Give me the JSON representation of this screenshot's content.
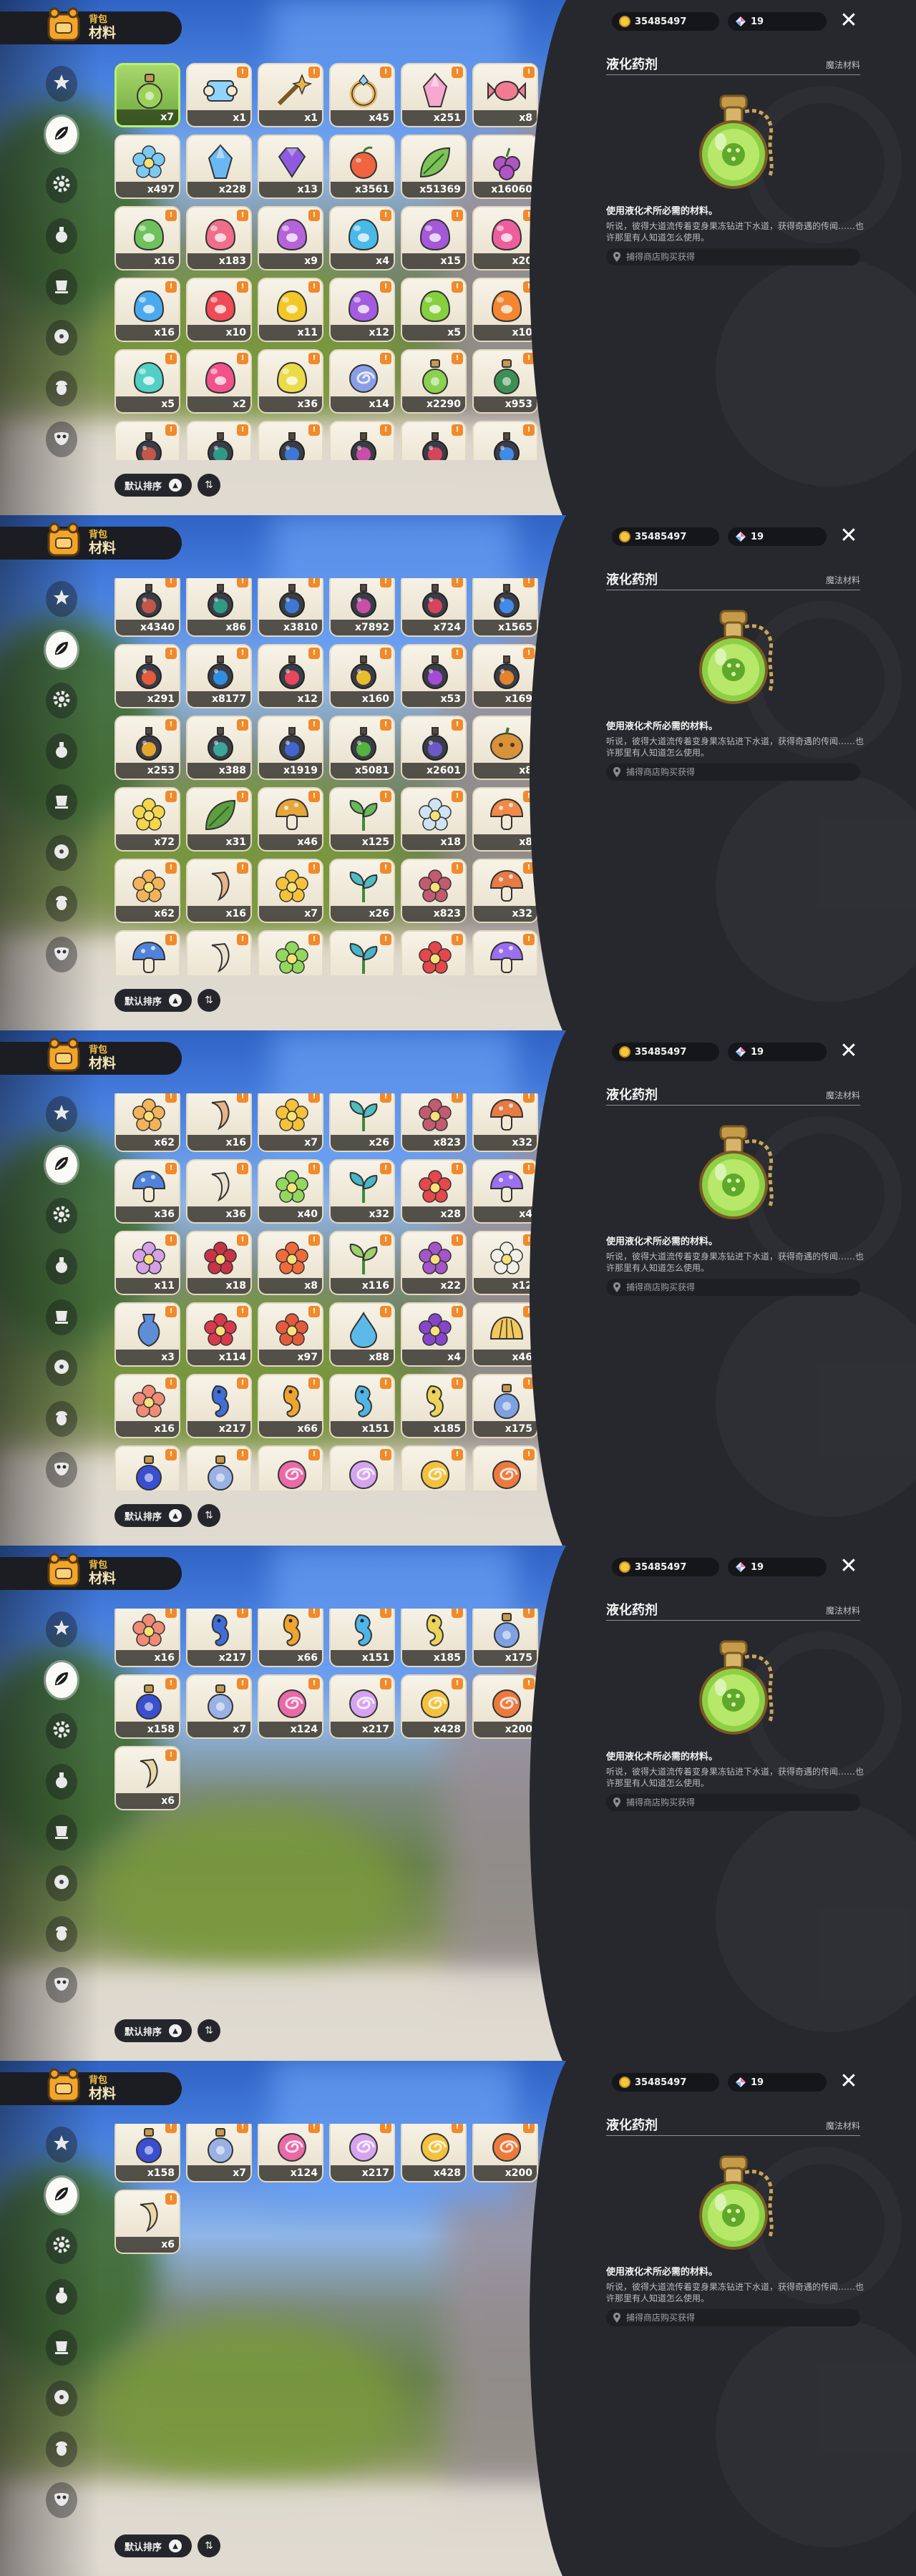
{
  "header": {
    "small_label": "背包",
    "title": "材料"
  },
  "currency": {
    "gold": "35485497",
    "gems": "19"
  },
  "detail": {
    "name": "液化药剂",
    "category": "魔法材料",
    "description": "使用液化术所必需的材料。",
    "lore": "听说，彼得大道流传着变身果冻钻进下水道，获得奇遇的传闻……也许那里有人知道怎么使用。",
    "source": "捕得商店购买获得"
  },
  "sort": {
    "label": "默认排序",
    "direction_glyph": "▲",
    "toggle_glyph": "⇅"
  },
  "sidebar_icons": [
    "star-icon",
    "leaf-icon",
    "gear-icon",
    "potion-icon",
    "cup-icon",
    "ball-icon",
    "acorn-icon",
    "mask-icon"
  ],
  "selected_tab": 1,
  "scroll_offsets": [
    0,
    5,
    9,
    13,
    14
  ],
  "colors": {
    "accent_selected": "#b7f26a",
    "new_tag": "#f08a2b",
    "panel": "#26282d"
  },
  "items": [
    {
      "count": "x7",
      "icon": "potion",
      "color": "#9bd15a",
      "tag": ""
    },
    {
      "count": "x1",
      "icon": "scroll",
      "color": "#8fd3ff",
      "tag": "!"
    },
    {
      "count": "x1",
      "icon": "wand",
      "color": "#e7b34b",
      "tag": "!"
    },
    {
      "count": "x45",
      "icon": "ring",
      "color": "#e5b96a",
      "tag": "!"
    },
    {
      "count": "x251",
      "icon": "crystal",
      "color": "#f6a6cf",
      "tag": "!"
    },
    {
      "count": "x8",
      "icon": "candy",
      "color": "#f07c8f",
      "tag": "!"
    },
    {
      "count": "x497",
      "icon": "flower",
      "color": "#7cc9f2",
      "tag": ""
    },
    {
      "count": "x228",
      "icon": "crystal",
      "color": "#6ab8f3",
      "tag": ""
    },
    {
      "count": "x13",
      "icon": "gem",
      "color": "#8e5be0",
      "tag": ""
    },
    {
      "count": "x3561",
      "icon": "fruit",
      "color": "#f0643f",
      "tag": ""
    },
    {
      "count": "x51369",
      "icon": "leaf",
      "color": "#7cc356",
      "tag": ""
    },
    {
      "count": "x16060",
      "icon": "berry",
      "color": "#b055c6",
      "tag": ""
    },
    {
      "count": "x16",
      "icon": "jelly",
      "color": "#6ec25c",
      "tag": "!"
    },
    {
      "count": "x183",
      "icon": "jelly",
      "color": "#f06e8a",
      "tag": "!"
    },
    {
      "count": "x9",
      "icon": "jelly",
      "color": "#b563d8",
      "tag": "!"
    },
    {
      "count": "x4",
      "icon": "jelly",
      "color": "#49b9e8",
      "tag": "!"
    },
    {
      "count": "x15",
      "icon": "jelly",
      "color": "#a459d8",
      "tag": "!"
    },
    {
      "count": "x20",
      "icon": "jelly",
      "color": "#ec5f9c",
      "tag": "!"
    },
    {
      "count": "x16",
      "icon": "jelly",
      "color": "#4aa9ef",
      "tag": "!"
    },
    {
      "count": "x10",
      "icon": "jelly",
      "color": "#ef4a55",
      "tag": "!"
    },
    {
      "count": "x11",
      "icon": "jelly",
      "color": "#f3c724",
      "tag": "!"
    },
    {
      "count": "x12",
      "icon": "jelly",
      "color": "#a35ce0",
      "tag": "!"
    },
    {
      "count": "x5",
      "icon": "jelly",
      "color": "#86cf3e",
      "tag": "!"
    },
    {
      "count": "x10",
      "icon": "jelly",
      "color": "#f4862f",
      "tag": "!"
    },
    {
      "count": "x5",
      "icon": "jelly",
      "color": "#53d0c6",
      "tag": "!"
    },
    {
      "count": "x2",
      "icon": "jelly",
      "color": "#f2528a",
      "tag": "!"
    },
    {
      "count": "x36",
      "icon": "jelly",
      "color": "#e9dc48",
      "tag": "!"
    },
    {
      "count": "x14",
      "icon": "swirl",
      "color": "#8a9ee8",
      "tag": "!"
    },
    {
      "count": "x2290",
      "icon": "potion",
      "color": "#8bd14f",
      "tag": "!"
    },
    {
      "count": "x953",
      "icon": "potion",
      "color": "#3e8f55",
      "tag": "!"
    },
    {
      "count": "x4340",
      "icon": "bomb",
      "color": "#c1574b",
      "tag": "!"
    },
    {
      "count": "x86",
      "icon": "bomb",
      "color": "#2f9a86",
      "tag": "!"
    },
    {
      "count": "x3810",
      "icon": "bomb",
      "color": "#3d79d4",
      "tag": "!"
    },
    {
      "count": "x7892",
      "icon": "bomb",
      "color": "#c84fa7",
      "tag": "!"
    },
    {
      "count": "x724",
      "icon": "bomb",
      "color": "#d6455d",
      "tag": "!"
    },
    {
      "count": "x1565",
      "icon": "bomb",
      "color": "#418be8",
      "tag": "!"
    },
    {
      "count": "x291",
      "icon": "bomb",
      "color": "#e55c3d",
      "tag": "!"
    },
    {
      "count": "x8177",
      "icon": "bomb",
      "color": "#2d8ee2",
      "tag": "!"
    },
    {
      "count": "x12",
      "icon": "bomb",
      "color": "#e8475d",
      "tag": "!"
    },
    {
      "count": "x160",
      "icon": "bomb",
      "color": "#e9be2c",
      "tag": "!"
    },
    {
      "count": "x53",
      "icon": "bomb",
      "color": "#a44bd7",
      "tag": "!"
    },
    {
      "count": "x169",
      "icon": "bomb",
      "color": "#e4832d",
      "tag": "!"
    },
    {
      "count": "x253",
      "icon": "bomb",
      "color": "#e4a62e",
      "tag": "!"
    },
    {
      "count": "x388",
      "icon": "bomb",
      "color": "#3aa69b",
      "tag": "!"
    },
    {
      "count": "x1919",
      "icon": "bomb",
      "color": "#4266cf",
      "tag": "!"
    },
    {
      "count": "x5081",
      "icon": "bomb",
      "color": "#54b43d",
      "tag": "!"
    },
    {
      "count": "x2601",
      "icon": "bomb",
      "color": "#6d58c8",
      "tag": "!"
    },
    {
      "count": "x8",
      "icon": "pumpkin",
      "color": "#d8933a",
      "tag": ""
    },
    {
      "count": "x72",
      "icon": "flower",
      "color": "#f3d64a",
      "tag": "!"
    },
    {
      "count": "x31",
      "icon": "leaf",
      "color": "#5c9e40",
      "tag": "!"
    },
    {
      "count": "x46",
      "icon": "mushroom",
      "color": "#e7a63b",
      "tag": "!"
    },
    {
      "count": "x125",
      "icon": "sprout",
      "color": "#69b85a",
      "tag": "!"
    },
    {
      "count": "x18",
      "icon": "flower",
      "color": "#cfe3f2",
      "tag": "!"
    },
    {
      "count": "x8",
      "icon": "mushroom",
      "color": "#f08a48",
      "tag": "!"
    },
    {
      "count": "x62",
      "icon": "flower",
      "color": "#f2b35a",
      "tag": "!"
    },
    {
      "count": "x16",
      "icon": "root",
      "color": "#e7b487",
      "tag": "!"
    },
    {
      "count": "x7",
      "icon": "flower",
      "color": "#f4c23b",
      "tag": "!"
    },
    {
      "count": "x26",
      "icon": "sprout",
      "color": "#4fbcc2",
      "tag": "!"
    },
    {
      "count": "x823",
      "icon": "flower",
      "color": "#c25b6f",
      "tag": "!"
    },
    {
      "count": "x32",
      "icon": "mushroom",
      "color": "#e77a45",
      "tag": "!"
    },
    {
      "count": "x36",
      "icon": "mushroom",
      "color": "#4f83db",
      "tag": "!"
    },
    {
      "count": "x36",
      "icon": "root",
      "color": "#e9e1cf",
      "tag": "!"
    },
    {
      "count": "x40",
      "icon": "flower",
      "color": "#92d85f",
      "tag": "!"
    },
    {
      "count": "x32",
      "icon": "sprout",
      "color": "#47b6c8",
      "tag": "!"
    },
    {
      "count": "x28",
      "icon": "flower",
      "color": "#e5474a",
      "tag": "!"
    },
    {
      "count": "x4",
      "icon": "mushroom",
      "color": "#9a6ff0",
      "tag": "!"
    },
    {
      "count": "x11",
      "icon": "flower",
      "color": "#d4a1e6",
      "tag": "!"
    },
    {
      "count": "x18",
      "icon": "flower",
      "color": "#c83347",
      "tag": "!"
    },
    {
      "count": "x8",
      "icon": "flower",
      "color": "#f16a3b",
      "tag": "!"
    },
    {
      "count": "x116",
      "icon": "sprout",
      "color": "#9fd06c",
      "tag": "!"
    },
    {
      "count": "x22",
      "icon": "flower",
      "color": "#a455c9",
      "tag": "!"
    },
    {
      "count": "x12",
      "icon": "flower",
      "color": "#f1f0e8",
      "tag": "!"
    },
    {
      "count": "x3",
      "icon": "vase",
      "color": "#5e8fd6",
      "tag": "!"
    },
    {
      "count": "x114",
      "icon": "flower",
      "color": "#d93a4b",
      "tag": "!"
    },
    {
      "count": "x97",
      "icon": "flower",
      "color": "#e35b3c",
      "tag": "!"
    },
    {
      "count": "x88",
      "icon": "drop",
      "color": "#5db9e8",
      "tag": "!"
    },
    {
      "count": "x4",
      "icon": "flower",
      "color": "#8646c9",
      "tag": "!"
    },
    {
      "count": "x46",
      "icon": "shell",
      "color": "#f2c95a",
      "tag": "!"
    },
    {
      "count": "x16",
      "icon": "flower",
      "color": "#ef8b76",
      "tag": "!"
    },
    {
      "count": "x217",
      "icon": "seahorse",
      "color": "#3f6ed6",
      "tag": "!"
    },
    {
      "count": "x66",
      "icon": "seahorse",
      "color": "#f0a42d",
      "tag": "!"
    },
    {
      "count": "x151",
      "icon": "seahorse",
      "color": "#4fb5e6",
      "tag": "!"
    },
    {
      "count": "x185",
      "icon": "seahorse",
      "color": "#ecd45a",
      "tag": "!"
    },
    {
      "count": "x175",
      "icon": "potion",
      "color": "#7fa1e2",
      "tag": "!"
    },
    {
      "count": "x158",
      "icon": "potion",
      "color": "#3a4fd0",
      "tag": "!"
    },
    {
      "count": "x7",
      "icon": "potion",
      "color": "#9ab1e5",
      "tag": "!"
    },
    {
      "count": "x124",
      "icon": "swirl",
      "color": "#e86aa7",
      "tag": "!"
    },
    {
      "count": "x217",
      "icon": "swirl",
      "color": "#d6a3f0",
      "tag": "!"
    },
    {
      "count": "x428",
      "icon": "swirl",
      "color": "#f2c23f",
      "tag": "!"
    },
    {
      "count": "x200",
      "icon": "swirl",
      "color": "#ec7a3e",
      "tag": "!"
    },
    {
      "count": "x6",
      "icon": "root",
      "color": "#e9d7a6",
      "tag": "!"
    }
  ]
}
